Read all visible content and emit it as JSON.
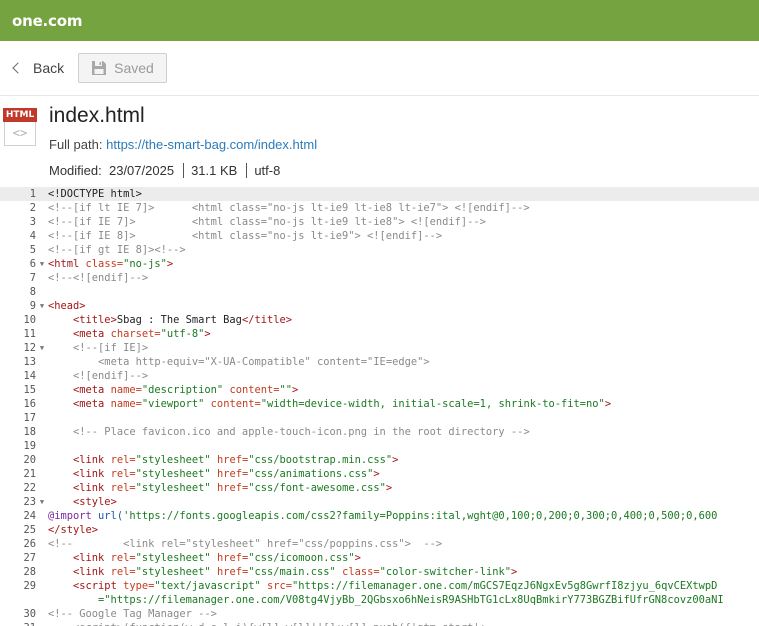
{
  "brand": {
    "logo": "one.com",
    "bar_color": "#74a33f"
  },
  "toolbar": {
    "back_label": "Back",
    "saved_label": "Saved"
  },
  "file": {
    "icon_badge": "HTML",
    "icon_glyph": "<>",
    "name": "index.html",
    "full_path_label": "Full path:",
    "full_path_url": "https://the-smart-bag.com/index.html",
    "modified_label": "Modified:",
    "modified_date": "23/07/2025",
    "size": "31.1 KB",
    "encoding": "utf-8"
  },
  "editor": {
    "lines": [
      {
        "n": "1",
        "fold": false,
        "active": true,
        "tokens": [
          [
            "t",
            "<!DOCTYPE html>"
          ]
        ]
      },
      {
        "n": "2",
        "fold": false,
        "tokens": [
          [
            "c",
            "<!--[if lt IE 7]>      <html class=\"no-js lt-ie9 lt-ie8 lt-ie7\"> <![endif]-->"
          ]
        ]
      },
      {
        "n": "3",
        "fold": false,
        "tokens": [
          [
            "c",
            "<!--[if IE 7]>         <html class=\"no-js lt-ie9 lt-ie8\"> <![endif]-->"
          ]
        ]
      },
      {
        "n": "4",
        "fold": false,
        "tokens": [
          [
            "c",
            "<!--[if IE 8]>         <html class=\"no-js lt-ie9\"> <![endif]-->"
          ]
        ]
      },
      {
        "n": "5",
        "fold": false,
        "tokens": [
          [
            "c",
            "<!--[if gt IE 8]><!-->"
          ]
        ]
      },
      {
        "n": "6",
        "fold": true,
        "tokens": [
          [
            "g",
            "<html "
          ],
          [
            "a",
            "class="
          ],
          [
            "v",
            "\"no-js\""
          ],
          [
            "g",
            ">"
          ]
        ]
      },
      {
        "n": "7",
        "fold": false,
        "tokens": [
          [
            "c",
            "<!--<![endif]-->"
          ]
        ]
      },
      {
        "n": "8",
        "fold": false,
        "tokens": []
      },
      {
        "n": "9",
        "fold": true,
        "tokens": [
          [
            "g",
            "<head>"
          ]
        ]
      },
      {
        "n": "10",
        "fold": false,
        "tokens": [
          [
            "t",
            "    "
          ],
          [
            "g",
            "<title>"
          ],
          [
            "t",
            "Sbag : The Smart Bag"
          ],
          [
            "g",
            "</title>"
          ]
        ]
      },
      {
        "n": "11",
        "fold": false,
        "tokens": [
          [
            "t",
            "    "
          ],
          [
            "g",
            "<meta "
          ],
          [
            "a",
            "charset="
          ],
          [
            "v",
            "\"utf-8\""
          ],
          [
            "g",
            ">"
          ]
        ]
      },
      {
        "n": "12",
        "fold": true,
        "tokens": [
          [
            "t",
            "    "
          ],
          [
            "c",
            "<!--[if IE]>"
          ]
        ]
      },
      {
        "n": "13",
        "fold": false,
        "tokens": [
          [
            "t",
            "    "
          ],
          [
            "c",
            "    <meta http-equiv=\"X-UA-Compatible\" content=\"IE=edge\">"
          ]
        ]
      },
      {
        "n": "14",
        "fold": false,
        "tokens": [
          [
            "t",
            "    "
          ],
          [
            "c",
            "<![endif]-->"
          ]
        ]
      },
      {
        "n": "15",
        "fold": false,
        "tokens": [
          [
            "t",
            "    "
          ],
          [
            "g",
            "<meta "
          ],
          [
            "a",
            "name="
          ],
          [
            "v",
            "\"description\""
          ],
          [
            "a",
            " content="
          ],
          [
            "v",
            "\"\""
          ],
          [
            "g",
            ">"
          ]
        ]
      },
      {
        "n": "16",
        "fold": false,
        "tokens": [
          [
            "t",
            "    "
          ],
          [
            "g",
            "<meta "
          ],
          [
            "a",
            "name="
          ],
          [
            "v",
            "\"viewport\""
          ],
          [
            "a",
            " content="
          ],
          [
            "v",
            "\"width=device-width, initial-scale=1, shrink-to-fit=no\""
          ],
          [
            "g",
            ">"
          ]
        ]
      },
      {
        "n": "17",
        "fold": false,
        "tokens": []
      },
      {
        "n": "18",
        "fold": false,
        "tokens": [
          [
            "t",
            "    "
          ],
          [
            "c",
            "<!-- Place favicon.ico and apple-touch-icon.png in the root directory -->"
          ]
        ]
      },
      {
        "n": "19",
        "fold": false,
        "tokens": []
      },
      {
        "n": "20",
        "fold": false,
        "tokens": [
          [
            "t",
            "    "
          ],
          [
            "g",
            "<link "
          ],
          [
            "a",
            "rel="
          ],
          [
            "v",
            "\"stylesheet\""
          ],
          [
            "a",
            " href="
          ],
          [
            "v",
            "\"css/bootstrap.min.css\""
          ],
          [
            "g",
            ">"
          ]
        ]
      },
      {
        "n": "21",
        "fold": false,
        "tokens": [
          [
            "t",
            "    "
          ],
          [
            "g",
            "<link "
          ],
          [
            "a",
            "rel="
          ],
          [
            "v",
            "\"stylesheet\""
          ],
          [
            "a",
            " href="
          ],
          [
            "v",
            "\"css/animations.css\""
          ],
          [
            "g",
            ">"
          ]
        ]
      },
      {
        "n": "22",
        "fold": false,
        "tokens": [
          [
            "t",
            "    "
          ],
          [
            "g",
            "<link "
          ],
          [
            "a",
            "rel="
          ],
          [
            "v",
            "\"stylesheet\""
          ],
          [
            "a",
            " href="
          ],
          [
            "v",
            "\"css/font-awesome.css\""
          ],
          [
            "g",
            ">"
          ]
        ]
      },
      {
        "n": "23",
        "fold": true,
        "tokens": [
          [
            "t",
            "    "
          ],
          [
            "g",
            "<style>"
          ]
        ]
      },
      {
        "n": "24",
        "fold": false,
        "tokens": [
          [
            "k",
            "@import "
          ],
          [
            "f",
            "url("
          ],
          [
            "v",
            "'https://fonts.googleapis.com/css2?family=Poppins:ital,wght@0,100;0,200;0,300;0,400;0,500;0,600"
          ]
        ]
      },
      {
        "n": "25",
        "fold": false,
        "tokens": [
          [
            "g",
            "</style>"
          ]
        ]
      },
      {
        "n": "26",
        "fold": false,
        "tokens": [
          [
            "c",
            "<!--        <link rel=\"stylesheet\" href=\"css/poppins.css\">  -->"
          ]
        ]
      },
      {
        "n": "27",
        "fold": false,
        "tokens": [
          [
            "t",
            "    "
          ],
          [
            "g",
            "<link "
          ],
          [
            "a",
            "rel="
          ],
          [
            "v",
            "\"stylesheet\""
          ],
          [
            "a",
            " href="
          ],
          [
            "v",
            "\"css/icomoon.css\""
          ],
          [
            "g",
            ">"
          ]
        ]
      },
      {
        "n": "28",
        "fold": false,
        "tokens": [
          [
            "t",
            "    "
          ],
          [
            "g",
            "<link "
          ],
          [
            "a",
            "rel="
          ],
          [
            "v",
            "\"stylesheet\""
          ],
          [
            "a",
            " href="
          ],
          [
            "v",
            "\"css/main.css\""
          ],
          [
            "a",
            " class="
          ],
          [
            "v",
            "\"color-switcher-link\""
          ],
          [
            "g",
            ">"
          ]
        ]
      },
      {
        "n": "29",
        "fold": false,
        "tokens": [
          [
            "t",
            "    "
          ],
          [
            "g",
            "<script "
          ],
          [
            "a",
            "type="
          ],
          [
            "v",
            "\"text/javascript\""
          ],
          [
            "a",
            " src="
          ],
          [
            "v",
            "\"https://filemanager.one.com/mGCS7EqzJ6NgxEv5g8GwrfI8zjyu_6qvCEXtwpD"
          ]
        ]
      },
      {
        "n": "",
        "fold": false,
        "tokens": [
          [
            "v",
            "        =\"https://filemanager.one.com/V08tg4VjyBb_2QGbsxo6hNeisR9ASHbTG1cLx8UqBmkirY773BGZBifUfrGN8covz00aNI"
          ]
        ]
      },
      {
        "n": "30",
        "fold": false,
        "tokens": [
          [
            "c",
            "<!-- Google Tag Manager -->"
          ]
        ]
      },
      {
        "n": "31",
        "fold": false,
        "tokens": [
          [
            "c",
            "    <script>(function(w,d,s,l,i){w[l]=w[l]||[];w[l].push({'gtm.start':"
          ]
        ]
      }
    ]
  }
}
